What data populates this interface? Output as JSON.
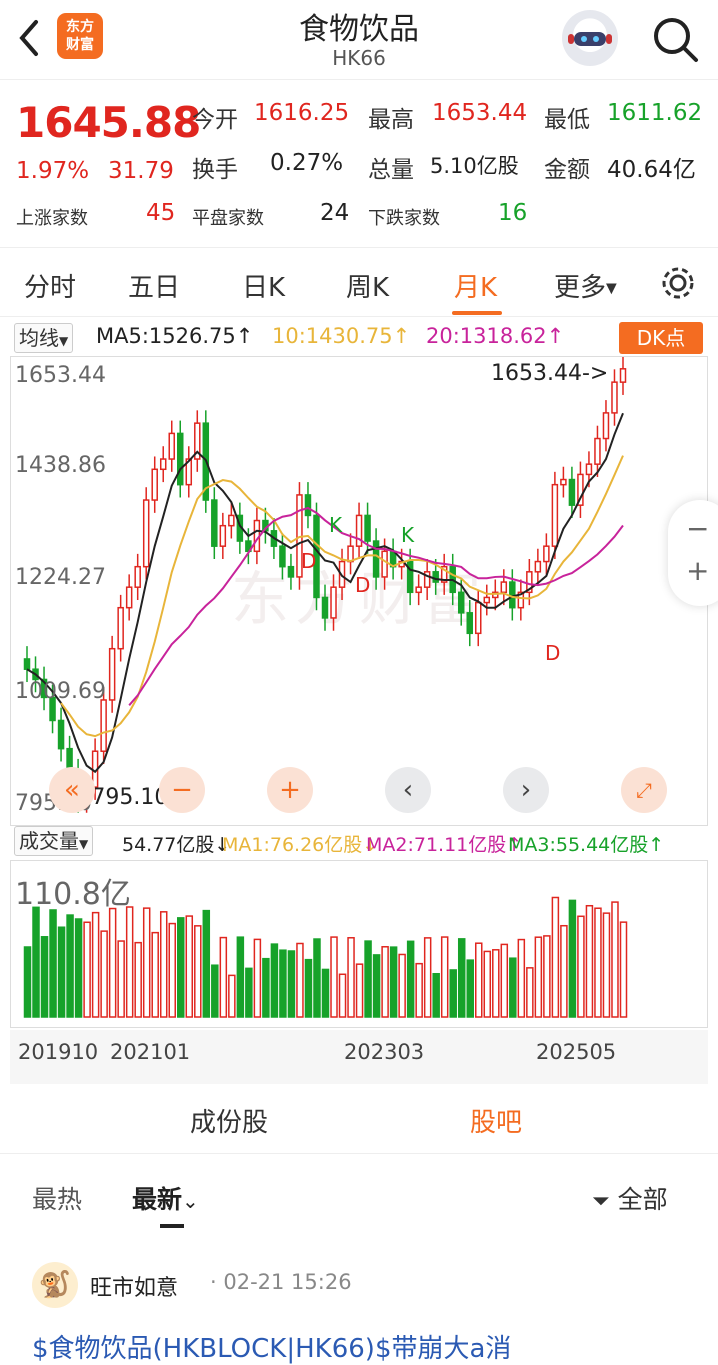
{
  "header": {
    "title": "食物饮品",
    "code": "HK66",
    "logo_line1": "东方",
    "logo_line2": "财富"
  },
  "quote": {
    "price": "1645.88",
    "change_pct": "1.97%",
    "change": "31.79",
    "open_label": "今开",
    "open": "1616.25",
    "high_label": "最高",
    "high": "1653.44",
    "low_label": "最低",
    "low": "1611.62",
    "turnover_label": "换手",
    "turnover": "0.27%",
    "volume_label": "总量",
    "volume": "5.10亿股",
    "amount_label": "金额",
    "amount": "40.64亿",
    "up_label": "上涨家数",
    "up": "45",
    "flat_label": "平盘家数",
    "flat": "24",
    "down_label": "下跌家数",
    "down": "16"
  },
  "tabs": [
    "分时",
    "五日",
    "日K",
    "周K",
    "月K",
    "更多"
  ],
  "active_tab": "月K",
  "ma": {
    "selector": "均线",
    "ma5": "MA5:1526.75↑",
    "ma10": "10:1430.75↑",
    "ma20": "20:1318.62↑",
    "dk_button": "DK点"
  },
  "price_axis": [
    "1653.44",
    "1438.86",
    "1224.27",
    "1009.69",
    "795.10"
  ],
  "annotations": {
    "high_mark": "1653.44->",
    "low_mark": "<-795.10"
  },
  "signals": [
    "K",
    "K",
    "D",
    "D",
    "D"
  ],
  "volume": {
    "selector": "成交量",
    "current": "54.77亿股↓",
    "ma1": "MA1:76.26亿股↓",
    "ma2": "MA2:71.11亿股↑",
    "ma3": "MA3:55.44亿股↑",
    "axis_max": "110.8亿"
  },
  "x_axis": [
    "201910",
    "202101",
    "202303",
    "202505"
  ],
  "colors": {
    "accent": "#f46c21",
    "up": "#e0261f",
    "down": "#17a22a",
    "ma5": "#222222",
    "ma10": "#e8b53a",
    "ma20": "#c8239b"
  },
  "sub_tabs": [
    "成份股",
    "股吧"
  ],
  "active_sub_tab": "股吧",
  "filters": {
    "hot": "最热",
    "latest": "最新",
    "all": "全部"
  },
  "post": {
    "author": "旺市如意",
    "time": "· 02-21 15:26",
    "text": "$食物饮品(HKBLOCK|HK66)$带崩大a消"
  },
  "chart_data": {
    "type": "candlestick",
    "title": "食物饮品 HK66 月K",
    "ylim": [
      795.1,
      1653.44
    ],
    "y_ticks": [
      1653.44,
      1438.86,
      1224.27,
      1009.69,
      795.1
    ],
    "x_ticks": [
      "201910",
      "202101",
      "202303",
      "202505"
    ],
    "high": 1653.44,
    "low": 795.1,
    "last": 1645.88,
    "ma_last": {
      "MA5": 1526.75,
      "MA10": 1430.75,
      "MA20": 1318.62
    },
    "volume_max": "110.8亿",
    "volume_ma_last": {
      "MA1": 76.26,
      "MA2": 71.11,
      "MA3": 55.44
    }
  }
}
